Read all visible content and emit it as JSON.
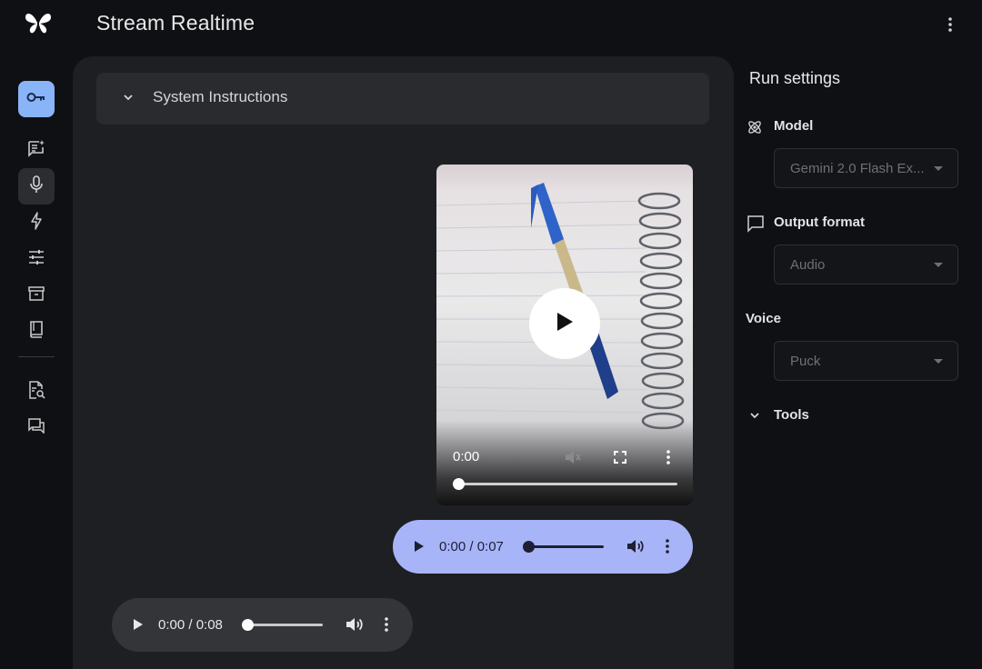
{
  "app": {
    "title": "Stream Realtime"
  },
  "colors": {
    "accent": "#8ab4f8",
    "user_audio_bg": "#a8b4f8",
    "panel_bg": "#1e1f22"
  },
  "sidebar": {
    "items": [
      {
        "icon": "key-icon",
        "active": true
      },
      {
        "icon": "new-chat-icon"
      },
      {
        "icon": "mic-icon",
        "selected": true
      },
      {
        "icon": "bolt-icon"
      },
      {
        "icon": "tune-icon"
      },
      {
        "icon": "archive-icon"
      },
      {
        "icon": "book-icon"
      },
      {
        "icon": "doc-search-icon"
      },
      {
        "icon": "forum-icon"
      }
    ]
  },
  "main": {
    "system_instructions_label": "System Instructions",
    "video": {
      "time": "0:00",
      "progress": 0
    },
    "user_audio": {
      "time": "0:00 / 0:07",
      "progress": 0
    },
    "model_audio": {
      "time": "0:00 / 0:08",
      "progress": 0
    }
  },
  "settings": {
    "title": "Run settings",
    "model": {
      "label": "Model",
      "value": "Gemini 2.0 Flash Ex..."
    },
    "output_format": {
      "label": "Output format",
      "value": "Audio"
    },
    "voice": {
      "label": "Voice",
      "value": "Puck"
    },
    "tools": {
      "label": "Tools"
    }
  }
}
